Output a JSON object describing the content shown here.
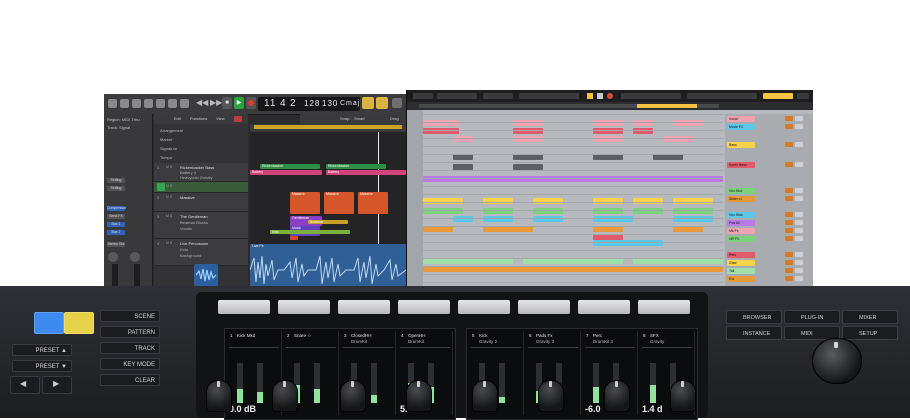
{
  "logic": {
    "inspector": {
      "region_label": "Region: MIDI Thru",
      "track_label": "Track: Signal",
      "setting_1": "Setting",
      "setting_2": "Setting",
      "compressor": "Compressor",
      "send_fx": "Send FX",
      "bus_1": "Bus 1",
      "bus_2": "Bus 2",
      "stereo_out": "Stereo Out"
    },
    "lcd": {
      "bar": "11",
      "beat": "4",
      "sub": "2",
      "tempo": "128",
      "tempo2": "130",
      "key": "Cmaj"
    },
    "menu": {
      "edit": "Edit",
      "functions": "Functions",
      "view": "View",
      "snap_label": "Snap:",
      "snap_value": "Smart",
      "drag": "Drag"
    },
    "globals": [
      "Arrangement",
      "Marker",
      "Signature",
      "Tempo"
    ],
    "tracks": [
      {
        "num": "1",
        "name": "Rickenbacker Bass",
        "sub": "Battery 4",
        "sub2": "Heavycoin Gravity"
      },
      {
        "num": "2",
        "name": "Massive",
        "sub": "",
        "sub2": ""
      },
      {
        "num": "3",
        "name": "The Gentleman",
        "sub": "Beatmar Blocks",
        "sub2": "Vocals"
      },
      {
        "num": "4",
        "name": "Live Percussion",
        "sub": "Koto",
        "sub2": "Background"
      }
    ],
    "regions": {
      "rickenbacker_1": "Rickenbacker",
      "rickenbacker_2": "Rickenbacker",
      "battery_1": "Battery",
      "battery_2": "Battery",
      "massive_1": "Massive",
      "massive_2": "Massive",
      "massive_3": "Massive",
      "gentleman": "Gentleman",
      "music": "Music",
      "beatmar": "Beatmar",
      "koto": "Koto",
      "live_perc": "Live Pe"
    }
  },
  "live": {
    "right_tracks": [
      "Vocal",
      "Mode FX",
      "Bass",
      "Synth Bass",
      "Vox Stut",
      "Slider Lt",
      "Vox Slds",
      "Pos Ali",
      "Ms Fx",
      "NR FX",
      "Perc",
      "Grav",
      "Tail",
      "Ext"
    ]
  },
  "hardware": {
    "left_buttons": [
      "SCENE",
      "PATTERN",
      "TRACK",
      "KEY MODE",
      "CLEAR"
    ],
    "preset_up": "PRESET",
    "preset_down": "PRESET",
    "screen_left": [
      {
        "num": "1",
        "name": "Kick Mkd",
        "sub": "",
        "value": "0.0 dB",
        "level": 0.35
      },
      {
        "num": "2",
        "name": "Snare ☆",
        "sub": "",
        "value": "",
        "level": 0.45
      },
      {
        "num": "3",
        "name": "ClosedHH",
        "sub": "DrumKit",
        "value": "",
        "level": 0.25
      },
      {
        "num": "4",
        "name": "OpenHH",
        "sub": "DrumKit",
        "value": "5.0",
        "level": 0.5
      }
    ],
    "screen_right": [
      {
        "num": "5",
        "name": "Kick",
        "sub": "Gravity 2",
        "value": "",
        "level": 0.2
      },
      {
        "num": "6",
        "name": "Pads Fx",
        "sub": "Gravity 3",
        "value": "",
        "level": 0.3
      },
      {
        "num": "7",
        "name": "Perc",
        "sub": "DrumKit 3",
        "value": "-6.0",
        "level": 0.4
      },
      {
        "num": "8",
        "name": "SFX",
        "sub": "Gravity",
        "value": "1.4 d",
        "level": 0.45
      }
    ],
    "right_buttons": {
      "browser": "BROWSER",
      "plugin": "PLUG-IN",
      "mixer": "MIXER",
      "instance": "INSTANCE",
      "midi": "MIDI",
      "setup": "SETUP"
    },
    "colors": {
      "blue_button": "#3d8bf0",
      "yellow_button": "#e8d24a",
      "meter_green": "#8fe39c"
    }
  }
}
